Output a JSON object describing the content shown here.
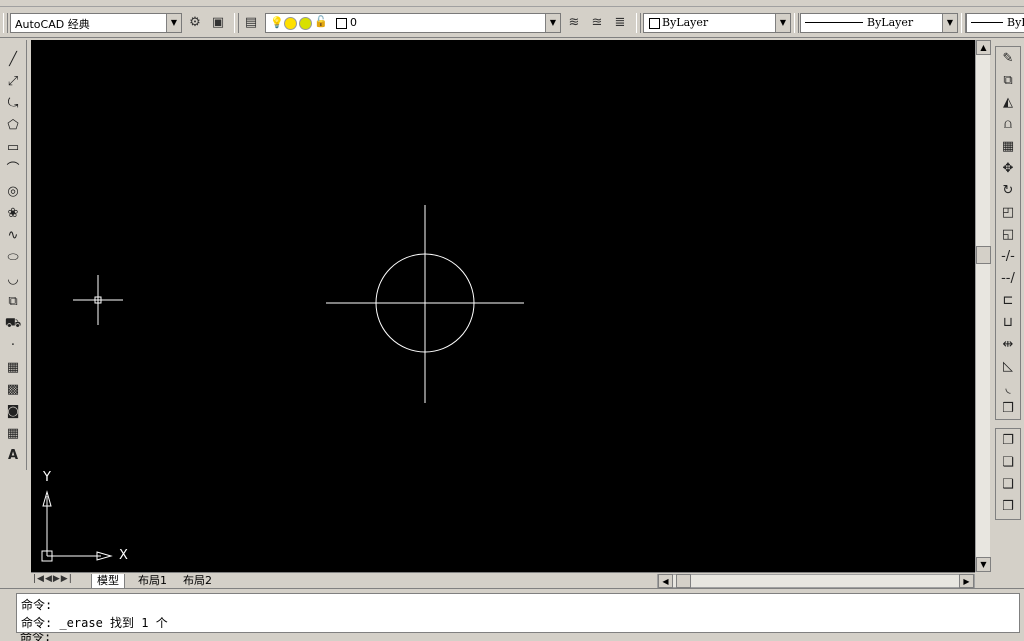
{
  "workspace": {
    "value": "AutoCAD 经典"
  },
  "layer": {
    "current": "0"
  },
  "properties": {
    "color": "ByLayer",
    "linetype": "ByLayer",
    "lineweight": "ByL"
  },
  "tabs": [
    {
      "label": "模型",
      "active": true
    },
    {
      "label": "布局1",
      "active": false
    },
    {
      "label": "布局2",
      "active": false
    }
  ],
  "ucs": {
    "x_label": "X",
    "y_label": "Y"
  },
  "command": {
    "line1": "命令:",
    "line2": "命令: _erase 找到 1 个",
    "line3": "命令:"
  },
  "colors": {
    "canvas": "#000000",
    "entity": "#ffffff",
    "toolbar": "#d4d0c8"
  }
}
